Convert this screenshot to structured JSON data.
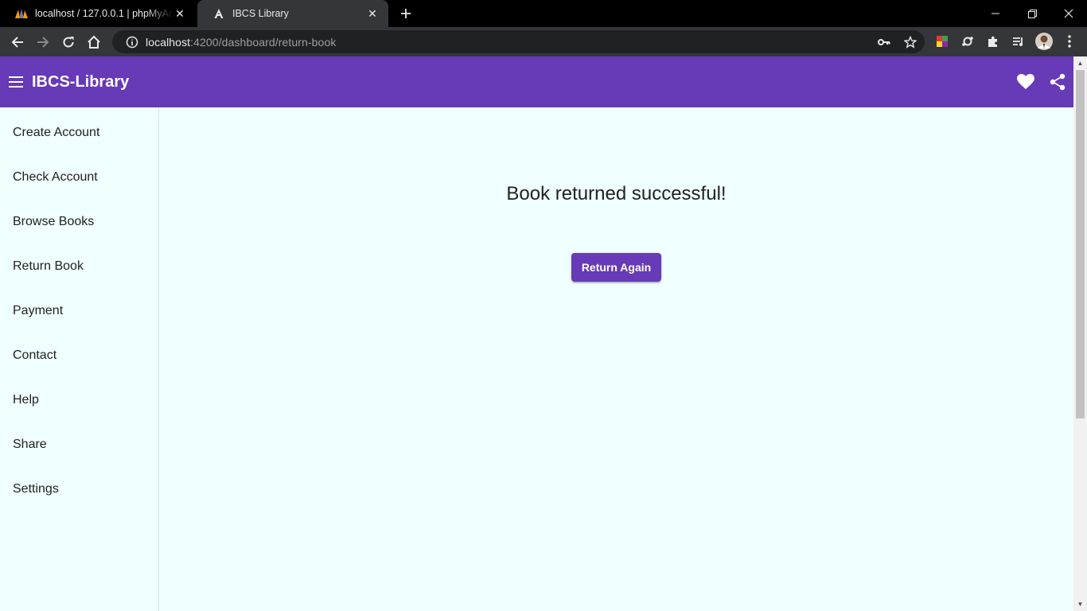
{
  "browser": {
    "tabs": [
      {
        "title": "localhost / 127.0.0.1 | phpMyAdmin",
        "icon": "phpmyadmin-icon",
        "active": false
      },
      {
        "title": "IBCS Library",
        "icon": "angular-icon",
        "active": true
      }
    ],
    "url_host": "localhost",
    "url_path": ":4200/dashboard/return-book"
  },
  "app": {
    "title": "IBCS-Library",
    "accent_color": "#673ab7",
    "background_color": "#f0ffff",
    "nav_items": [
      {
        "label": "Create Account"
      },
      {
        "label": "Check Account"
      },
      {
        "label": "Browse Books"
      },
      {
        "label": "Return Book"
      },
      {
        "label": "Payment"
      },
      {
        "label": "Contact"
      },
      {
        "label": "Help"
      },
      {
        "label": "Share"
      },
      {
        "label": "Settings"
      }
    ],
    "message": "Book returned successful!",
    "button_label": "Return Again"
  }
}
